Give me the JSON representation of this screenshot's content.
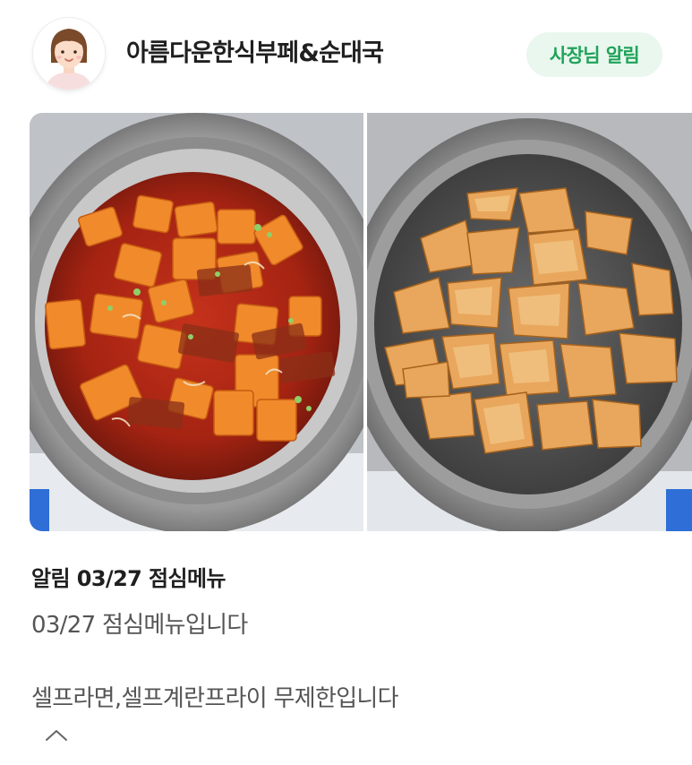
{
  "header": {
    "store_name": "아름다운한식부페&순대국",
    "badge_label": "사장님 알림",
    "avatar_icon": "owner-avatar-icon"
  },
  "photos": [
    {
      "name": "photo-spicy-stew",
      "description_icon": "food-photo"
    },
    {
      "name": "photo-fried-cutlet",
      "description_icon": "food-photo"
    }
  ],
  "post": {
    "title": "알림 03/27 점심메뉴",
    "subtitle": "03/27 점심메뉴입니다",
    "body": "셀프라면,셀프계란프라이 무제한입니다",
    "collapse_icon": "chevron-up-icon"
  },
  "colors": {
    "badge_bg": "#e9f7ee",
    "badge_text": "#1fa35a",
    "title_text": "#1f1f1f",
    "body_text": "#555555"
  }
}
